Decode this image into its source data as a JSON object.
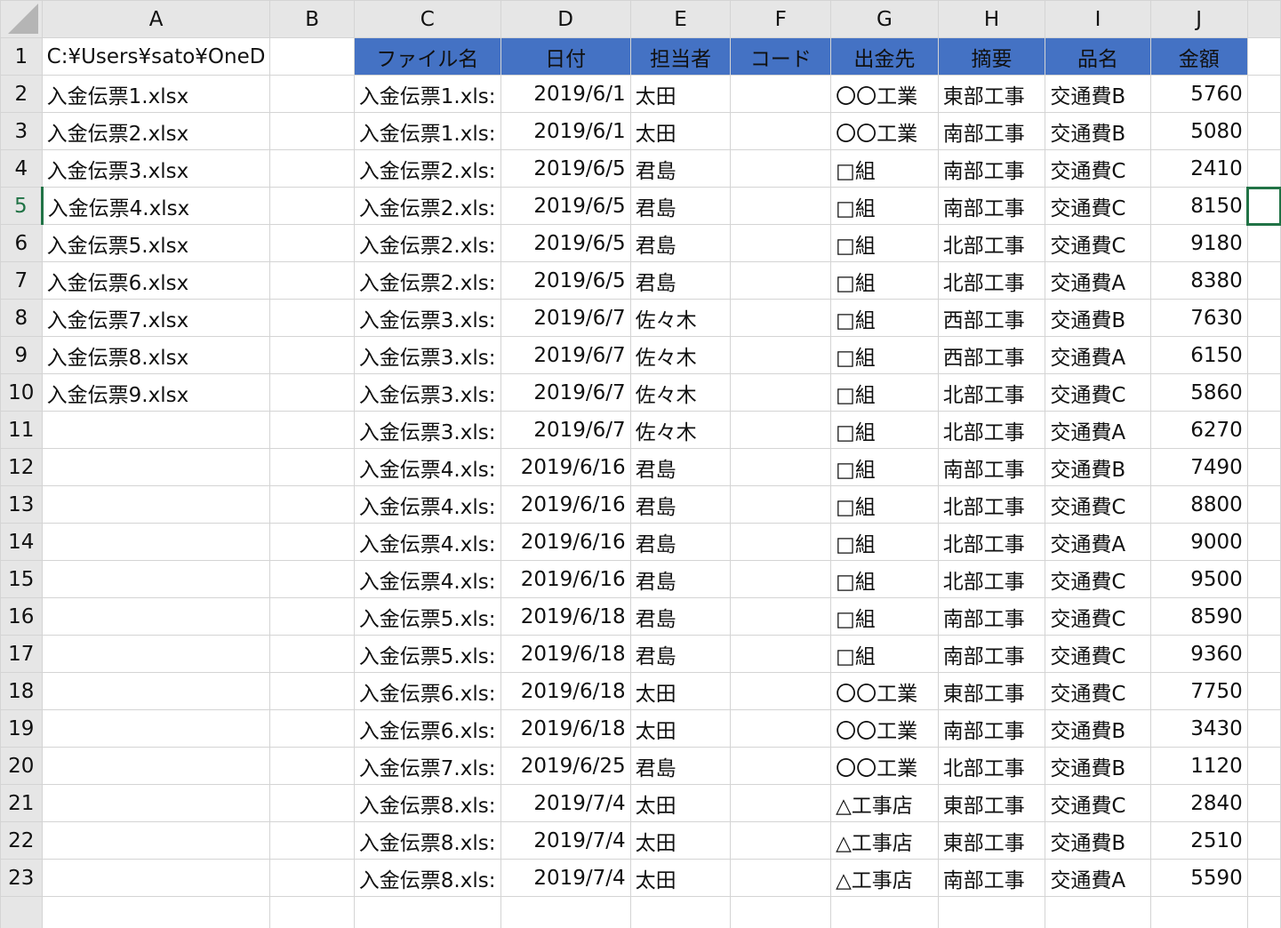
{
  "columns": [
    "A",
    "B",
    "C",
    "D",
    "E",
    "F",
    "G",
    "H",
    "I",
    "J"
  ],
  "a1_value": "C:¥Users¥sato¥OneD",
  "headers": {
    "c": "ファイル名",
    "d": "日付",
    "e": "担当者",
    "f": "コード",
    "g": "出金先",
    "h": "摘要",
    "i": "品名",
    "j": "金額"
  },
  "rows": [
    {
      "num": "2",
      "a": "入金伝票1.xlsx",
      "c": "入金伝票1.xls:",
      "d": "2019/6/1",
      "e": "太田",
      "f": "",
      "g": "〇〇工業",
      "h": "東部工事",
      "i": "交通費B",
      "j": "5760"
    },
    {
      "num": "3",
      "a": "入金伝票2.xlsx",
      "c": "入金伝票1.xls:",
      "d": "2019/6/1",
      "e": "太田",
      "f": "",
      "g": "〇〇工業",
      "h": "南部工事",
      "i": "交通費B",
      "j": "5080"
    },
    {
      "num": "4",
      "a": "入金伝票3.xlsx",
      "c": "入金伝票2.xls:",
      "d": "2019/6/5",
      "e": "君島",
      "f": "",
      "g": "□組",
      "h": "南部工事",
      "i": "交通費C",
      "j": "2410"
    },
    {
      "num": "5",
      "a": "入金伝票4.xlsx",
      "c": "入金伝票2.xls:",
      "d": "2019/6/5",
      "e": "君島",
      "f": "",
      "g": "□組",
      "h": "南部工事",
      "i": "交通費C",
      "j": "8150"
    },
    {
      "num": "6",
      "a": "入金伝票5.xlsx",
      "c": "入金伝票2.xls:",
      "d": "2019/6/5",
      "e": "君島",
      "f": "",
      "g": "□組",
      "h": "北部工事",
      "i": "交通費C",
      "j": "9180"
    },
    {
      "num": "7",
      "a": "入金伝票6.xlsx",
      "c": "入金伝票2.xls:",
      "d": "2019/6/5",
      "e": "君島",
      "f": "",
      "g": "□組",
      "h": "北部工事",
      "i": "交通費A",
      "j": "8380"
    },
    {
      "num": "8",
      "a": "入金伝票7.xlsx",
      "c": "入金伝票3.xls:",
      "d": "2019/6/7",
      "e": "佐々木",
      "f": "",
      "g": "□組",
      "h": "西部工事",
      "i": "交通費B",
      "j": "7630"
    },
    {
      "num": "9",
      "a": "入金伝票8.xlsx",
      "c": "入金伝票3.xls:",
      "d": "2019/6/7",
      "e": "佐々木",
      "f": "",
      "g": "□組",
      "h": "西部工事",
      "i": "交通費A",
      "j": "6150"
    },
    {
      "num": "10",
      "a": "入金伝票9.xlsx",
      "c": "入金伝票3.xls:",
      "d": "2019/6/7",
      "e": "佐々木",
      "f": "",
      "g": "□組",
      "h": "北部工事",
      "i": "交通費C",
      "j": "5860"
    },
    {
      "num": "11",
      "a": "",
      "c": "入金伝票3.xls:",
      "d": "2019/6/7",
      "e": "佐々木",
      "f": "",
      "g": "□組",
      "h": "北部工事",
      "i": "交通費A",
      "j": "6270"
    },
    {
      "num": "12",
      "a": "",
      "c": "入金伝票4.xls:",
      "d": "2019/6/16",
      "e": "君島",
      "f": "",
      "g": "□組",
      "h": "南部工事",
      "i": "交通費B",
      "j": "7490"
    },
    {
      "num": "13",
      "a": "",
      "c": "入金伝票4.xls:",
      "d": "2019/6/16",
      "e": "君島",
      "f": "",
      "g": "□組",
      "h": "北部工事",
      "i": "交通費C",
      "j": "8800"
    },
    {
      "num": "14",
      "a": "",
      "c": "入金伝票4.xls:",
      "d": "2019/6/16",
      "e": "君島",
      "f": "",
      "g": "□組",
      "h": "北部工事",
      "i": "交通費A",
      "j": "9000"
    },
    {
      "num": "15",
      "a": "",
      "c": "入金伝票4.xls:",
      "d": "2019/6/16",
      "e": "君島",
      "f": "",
      "g": "□組",
      "h": "北部工事",
      "i": "交通費C",
      "j": "9500"
    },
    {
      "num": "16",
      "a": "",
      "c": "入金伝票5.xls:",
      "d": "2019/6/18",
      "e": "君島",
      "f": "",
      "g": "□組",
      "h": "南部工事",
      "i": "交通費C",
      "j": "8590"
    },
    {
      "num": "17",
      "a": "",
      "c": "入金伝票5.xls:",
      "d": "2019/6/18",
      "e": "君島",
      "f": "",
      "g": "□組",
      "h": "南部工事",
      "i": "交通費C",
      "j": "9360"
    },
    {
      "num": "18",
      "a": "",
      "c": "入金伝票6.xls:",
      "d": "2019/6/18",
      "e": "太田",
      "f": "",
      "g": "〇〇工業",
      "h": "東部工事",
      "i": "交通費C",
      "j": "7750"
    },
    {
      "num": "19",
      "a": "",
      "c": "入金伝票6.xls:",
      "d": "2019/6/18",
      "e": "太田",
      "f": "",
      "g": "〇〇工業",
      "h": "南部工事",
      "i": "交通費B",
      "j": "3430"
    },
    {
      "num": "20",
      "a": "",
      "c": "入金伝票7.xls:",
      "d": "2019/6/25",
      "e": "君島",
      "f": "",
      "g": "〇〇工業",
      "h": "北部工事",
      "i": "交通費B",
      "j": "1120"
    },
    {
      "num": "21",
      "a": "",
      "c": "入金伝票8.xls:",
      "d": "2019/7/4",
      "e": "太田",
      "f": "",
      "g": "△工事店",
      "h": "東部工事",
      "i": "交通費C",
      "j": "2840"
    },
    {
      "num": "22",
      "a": "",
      "c": "入金伝票8.xls:",
      "d": "2019/7/4",
      "e": "太田",
      "f": "",
      "g": "△工事店",
      "h": "東部工事",
      "i": "交通費B",
      "j": "2510"
    },
    {
      "num": "23",
      "a": "",
      "c": "入金伝票8.xls:",
      "d": "2019/7/4",
      "e": "太田",
      "f": "",
      "g": "△工事店",
      "h": "南部工事",
      "i": "交通費A",
      "j": "5590"
    }
  ],
  "active_row": "5",
  "colors": {
    "header_fill": "#4472c4",
    "header_text": "#ffffff",
    "selection": "#217346"
  }
}
